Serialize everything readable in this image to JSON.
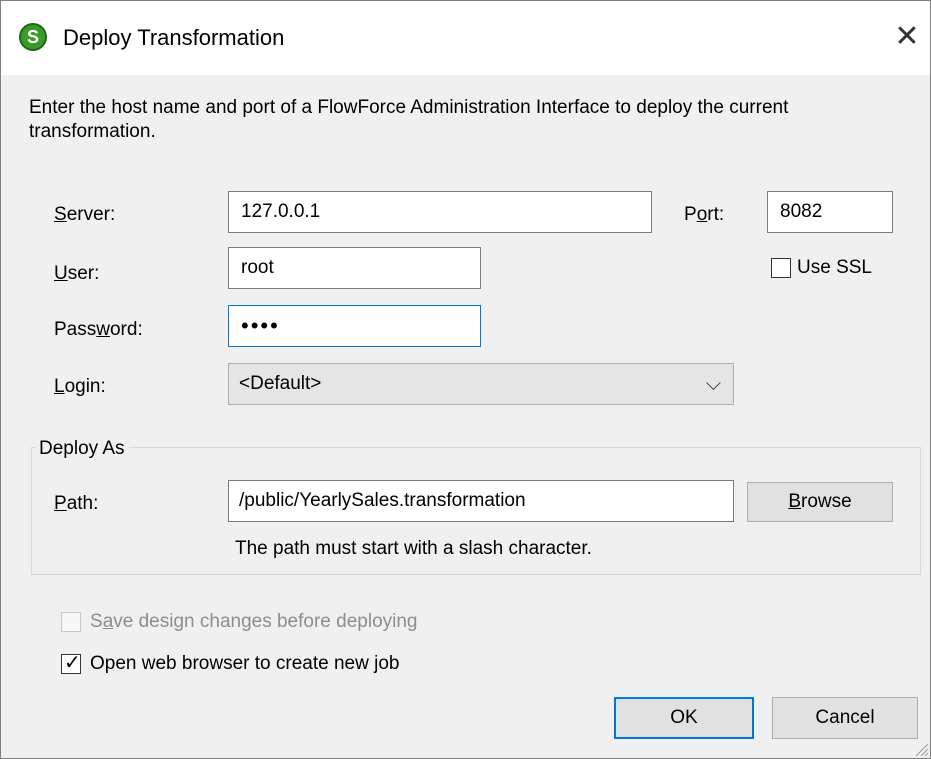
{
  "window": {
    "title": "Deploy Transformation",
    "app_icon": "mapforce-app-icon",
    "close_glyph": "✕"
  },
  "intro_text": "Enter the host name and port of a FlowForce Administration Interface to deploy the current transformation.",
  "form": {
    "server": {
      "label_u": "S",
      "label_rest": "erver:",
      "value": "127.0.0.1"
    },
    "port": {
      "label_a": "P",
      "label_u": "o",
      "label_b": "rt:",
      "value": "8082"
    },
    "use_ssl": {
      "label": "Use SSL",
      "checked": false
    },
    "user": {
      "label_u": "U",
      "label_rest": "ser:",
      "value": "root"
    },
    "password": {
      "label_a": "Pass",
      "label_u": "w",
      "label_b": "ord:",
      "value": "••••"
    },
    "login": {
      "label_u": "L",
      "label_rest": "ogin:",
      "value": "<Default>",
      "chevron": "⌵"
    }
  },
  "deploy_as": {
    "group_label": "Deploy As",
    "path": {
      "label_u": "P",
      "label_rest": "ath:",
      "value": "/public/YearlySales.transformation"
    },
    "browse_u": "B",
    "browse_rest": "rowse",
    "hint": "The path must start with a slash character."
  },
  "options": {
    "save_design": {
      "label_a": "S",
      "label_u": "a",
      "label_b": "ve design changes before deploying",
      "checked": false,
      "enabled": false
    },
    "open_browser": {
      "label_a": "Open web browser to create new ",
      "label_u": "j",
      "label_b": "ob",
      "checked": true,
      "enabled": true,
      "check_glyph": "✓"
    }
  },
  "buttons": {
    "ok": "OK",
    "cancel": "Cancel"
  },
  "colors": {
    "accent": "#0078d7",
    "dialog_bg": "#f0f0f0",
    "button_bg": "#e1e1e1",
    "disabled_text": "#8d8d8d"
  }
}
